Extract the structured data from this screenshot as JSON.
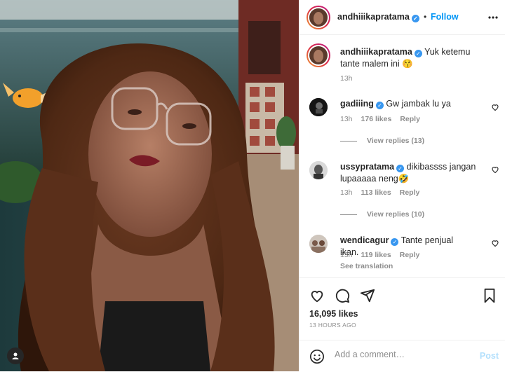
{
  "header": {
    "username": "andhiiikapratama",
    "separator": "•",
    "follow_label": "Follow"
  },
  "caption": {
    "username": "andhiiikapratama",
    "text": "Yuk ketemu tante malem ini 😚",
    "time": "13h"
  },
  "comments": [
    {
      "username": "gadiiing",
      "text": "Gw jambak lu ya",
      "time": "13h",
      "likes": "176 likes",
      "reply": "Reply",
      "view_replies": "View replies (13)"
    },
    {
      "username": "ussypratama",
      "text": "dikibassss jangan lupaaaaa neng🤣",
      "time": "13h",
      "likes": "113 likes",
      "reply": "Reply",
      "view_replies": "View replies (10)"
    },
    {
      "username": "wendicagur",
      "text": "Tante penjual ikan.",
      "time": "13h",
      "likes": "119 likes",
      "reply": "Reply",
      "see_translation": "See translation"
    }
  ],
  "post": {
    "likes": "16,095 likes",
    "ago": "13 HOURS AGO"
  },
  "add_comment": {
    "placeholder": "Add a comment…",
    "post_label": "Post"
  },
  "icons": {
    "like": "heart-icon",
    "comment": "comment-icon",
    "share": "share-icon",
    "save": "bookmark-icon",
    "emoji": "emoji-icon",
    "more": "more-icon",
    "tag": "user-tag-icon"
  },
  "colors": {
    "accent": "#0095f6",
    "verified": "#3897f0",
    "muted": "#8e8e8e"
  }
}
